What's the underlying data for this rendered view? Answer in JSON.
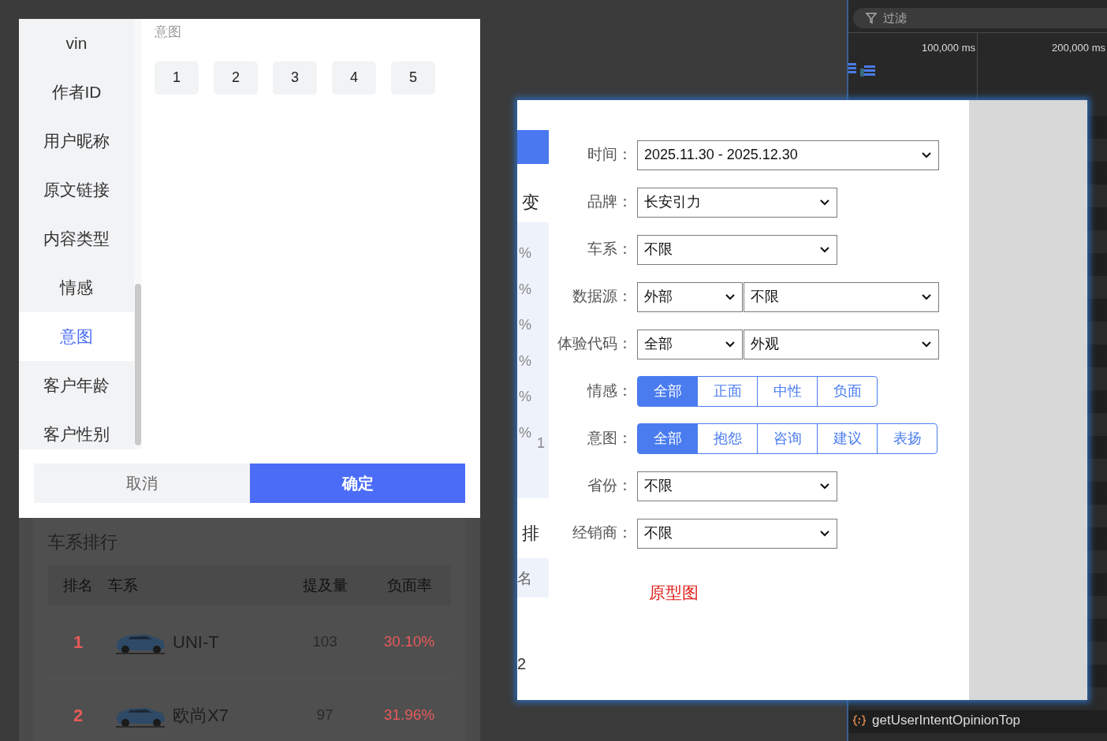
{
  "filter_popup": {
    "categories": [
      {
        "label": "vin",
        "selected": false
      },
      {
        "label": "作者ID",
        "selected": false
      },
      {
        "label": "用户昵称",
        "selected": false
      },
      {
        "label": "原文链接",
        "selected": false
      },
      {
        "label": "内容类型",
        "selected": false
      },
      {
        "label": "情感",
        "selected": false
      },
      {
        "label": "意图",
        "selected": true
      },
      {
        "label": "客户年龄",
        "selected": false
      },
      {
        "label": "客户性别",
        "selected": false
      }
    ],
    "section_title": "意图",
    "options": [
      "1",
      "2",
      "3",
      "4",
      "5"
    ],
    "cancel": "取消",
    "confirm": "确定"
  },
  "background_page": {
    "title": "车系排行",
    "columns": [
      "排名",
      "车系",
      "提及量",
      "负面率"
    ],
    "rows": [
      {
        "rank": "1",
        "series": "UNI-T",
        "mentions": "103",
        "negative_rate": "30.10%"
      },
      {
        "rank": "2",
        "series": "欧尚X7",
        "mentions": "97",
        "negative_rate": "31.96%"
      }
    ]
  },
  "behind_window": {
    "heading": "变",
    "axis_labels": [
      "%",
      "%",
      "%",
      "%",
      "%",
      "%"
    ],
    "axis_tick": "1",
    "ranking_heading": "排",
    "column": "名",
    "row": "2"
  },
  "form": {
    "fields": [
      {
        "kind": "select",
        "label": "时间：",
        "values": [
          "2025.11.30 - 2025.12.30"
        ],
        "wide": true
      },
      {
        "kind": "select",
        "label": "品牌：",
        "values": [
          "长安引力"
        ],
        "wide": false
      },
      {
        "kind": "select",
        "label": "车系：",
        "values": [
          "不限"
        ],
        "wide": false
      },
      {
        "kind": "select",
        "label": "数据源：",
        "values": [
          "外部",
          "不限"
        ],
        "wide": true
      },
      {
        "kind": "select",
        "label": "体验代码：",
        "values": [
          "全部",
          "外观"
        ],
        "wide": true
      },
      {
        "kind": "segmented",
        "label": "情感：",
        "options": [
          {
            "label": "全部",
            "selected": true
          },
          {
            "label": "正面",
            "selected": false
          },
          {
            "label": "中性",
            "selected": false
          },
          {
            "label": "负面",
            "selected": false
          }
        ]
      },
      {
        "kind": "segmented",
        "label": "意图：",
        "options": [
          {
            "label": "全部",
            "selected": true
          },
          {
            "label": "抱怨",
            "selected": false
          },
          {
            "label": "咨询",
            "selected": false
          },
          {
            "label": "建议",
            "selected": false
          },
          {
            "label": "表扬",
            "selected": false
          }
        ]
      },
      {
        "kind": "select",
        "label": "省份：",
        "values": [
          "不限"
        ],
        "wide": false
      },
      {
        "kind": "select",
        "label": "经销商：",
        "values": [
          "不限"
        ],
        "wide": false
      }
    ],
    "note": "原型图"
  },
  "devtools": {
    "filter_placeholder": "过滤",
    "ticks": [
      "100,000 ms",
      "200,000 ms"
    ],
    "entries": [
      "getUserIntentOpinionTop"
    ]
  }
}
